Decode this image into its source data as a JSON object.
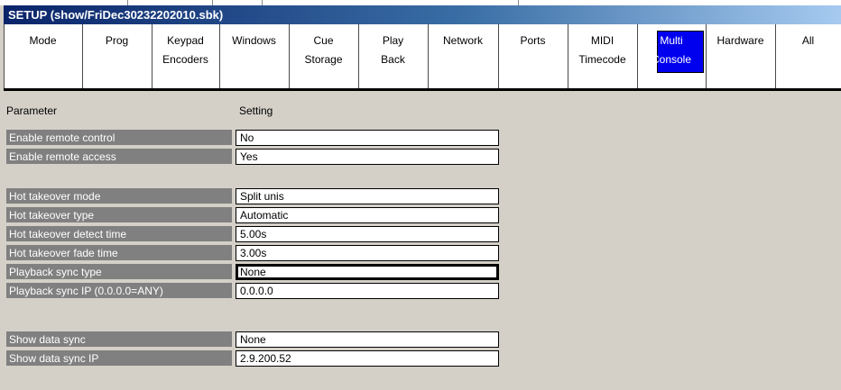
{
  "window": {
    "title": "SETUP (show/FriDec30232202010.sbk)"
  },
  "tabs": [
    {
      "label": "Mode"
    },
    {
      "label": "Prog"
    },
    {
      "label": "Keypad\nEncoders"
    },
    {
      "label": "Windows"
    },
    {
      "label": "Cue\nStorage"
    },
    {
      "label": "Play\nBack"
    },
    {
      "label": "Network"
    },
    {
      "label": "Ports"
    },
    {
      "label": "MIDI\nTimecode"
    },
    {
      "label": "Multi\nConsole",
      "active": true
    },
    {
      "label": "Hardware"
    },
    {
      "label": "All"
    }
  ],
  "table": {
    "headers": {
      "parameter": "Parameter",
      "setting": "Setting"
    },
    "rows": [
      {
        "parameter": "Enable remote control",
        "setting": "No"
      },
      {
        "parameter": "Enable remote access",
        "setting": "Yes"
      },
      {
        "parameter": "Hot takeover mode",
        "setting": "Split unis"
      },
      {
        "parameter": "Hot takeover type",
        "setting": "Automatic"
      },
      {
        "parameter": "Hot takeover detect time",
        "setting": "5.00s"
      },
      {
        "parameter": "Hot takeover fade time",
        "setting": "3.00s"
      },
      {
        "parameter": "Playback sync type",
        "setting": "None",
        "focused": true
      },
      {
        "parameter": "Playback sync IP (0.0.0.0=ANY)",
        "setting": "0.0.0.0"
      },
      {
        "parameter": "Show data sync",
        "setting": "None"
      },
      {
        "parameter": "Show data sync IP",
        "setting": "2.9.200.52"
      }
    ]
  },
  "colors": {
    "title_bar": "#0a246a",
    "active_tab": "#0000ee",
    "param_cell": "#808080",
    "background": "#d4d0c8"
  }
}
